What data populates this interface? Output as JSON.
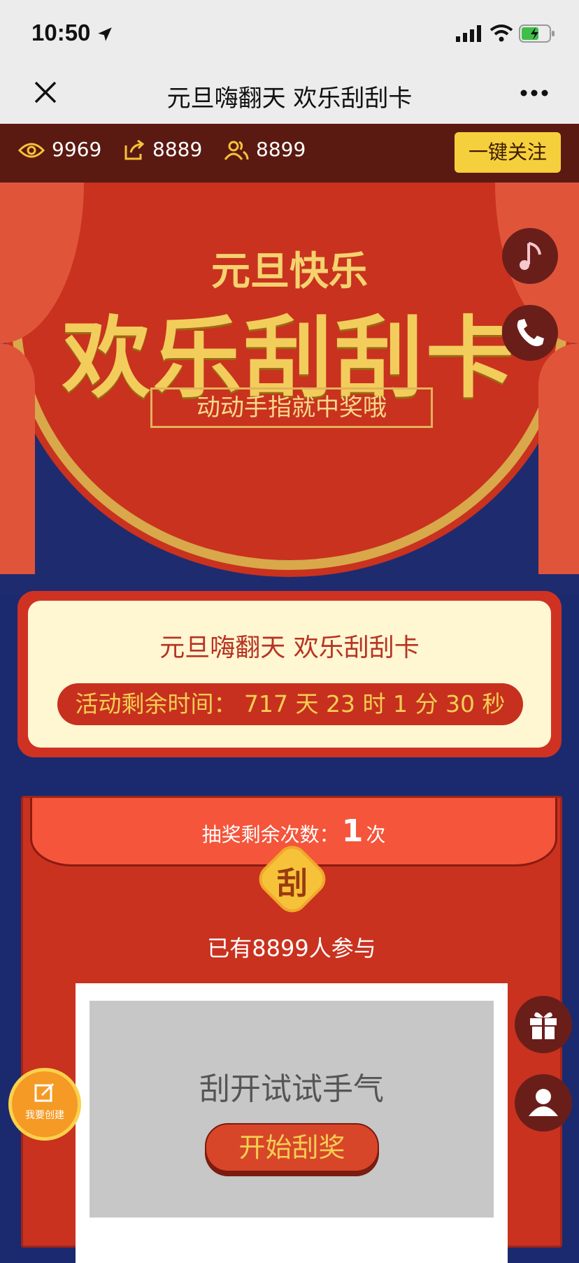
{
  "status_bar": {
    "time": "10:50"
  },
  "nav": {
    "title": "元旦嗨翻天 欢乐刮刮卡"
  },
  "stats": {
    "views": "9969",
    "shares": "8889",
    "participants": "8899",
    "follow_label": "一键关注"
  },
  "hero": {
    "subtitle": "元旦快乐",
    "title": "欢乐刮刮卡",
    "tagline": "动动手指就中奖哦"
  },
  "info_card": {
    "title": "元旦嗨翻天 欢乐刮刮卡",
    "countdown": "活动剩余时间：  717 天 23 时 1 分 30 秒"
  },
  "lottery": {
    "chances_label": "抽奖剩余次数：",
    "chances_value": "1",
    "chances_unit": "次",
    "badge": "刮",
    "participants_text": "已有8899人参与",
    "scratch_prompt": "刮开试试手气",
    "start_button": "开始刮奖"
  },
  "floating": {
    "create_label": "我要创建"
  },
  "icons": [
    "location-arrow-icon",
    "signal-icon",
    "wifi-icon",
    "battery-icon",
    "close-icon",
    "more-icon",
    "eye-icon",
    "share-icon",
    "people-icon",
    "music-icon",
    "phone-icon",
    "gift-icon",
    "user-icon",
    "edit-icon"
  ],
  "colors": {
    "primary_red": "#c9321f",
    "gold": "#f2cd5c",
    "navy": "#1b2a6e",
    "follow_yellow": "#f6cf3c"
  }
}
